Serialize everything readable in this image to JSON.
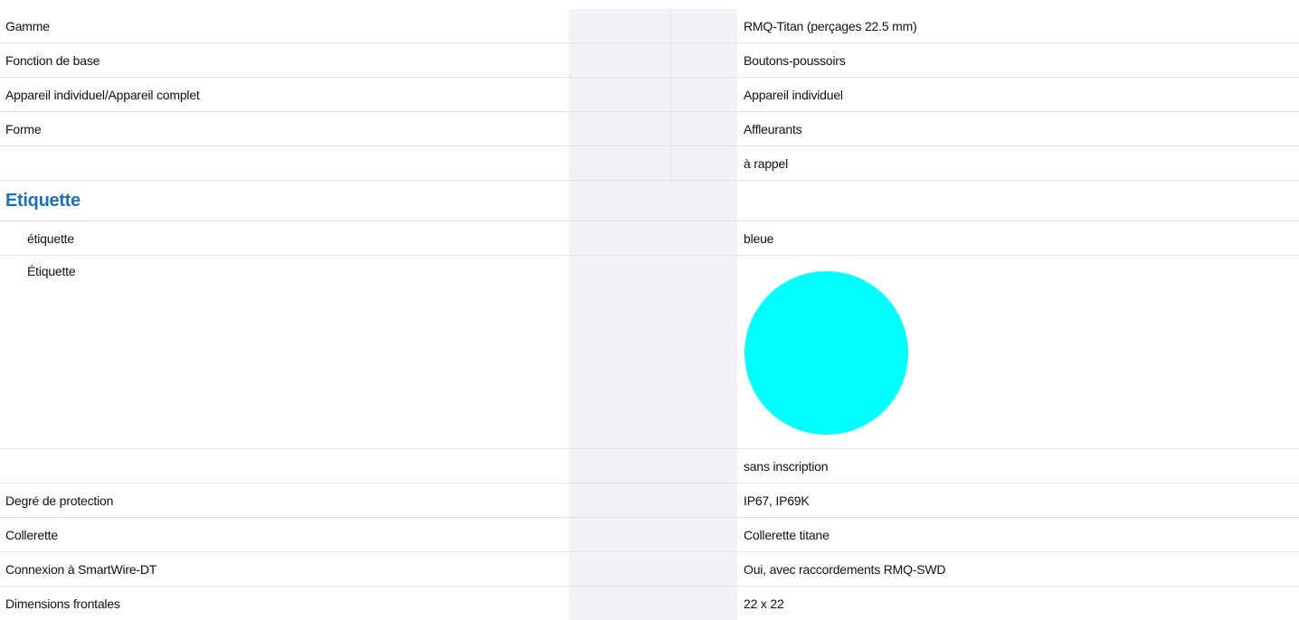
{
  "rows": [
    {
      "label": "Gamme",
      "value": "RMQ-Titan (perçages 22.5 mm)"
    },
    {
      "label": "Fonction de base",
      "value": "Boutons-poussoirs"
    },
    {
      "label": "Appareil individuel/Appareil complet",
      "value": "Appareil individuel"
    },
    {
      "label": "Forme",
      "value": "Affleurants"
    },
    {
      "label": "",
      "value": "à rappel"
    }
  ],
  "section": {
    "title": "Etiquette",
    "rows": [
      {
        "label": "étiquette",
        "value": "bleue"
      },
      {
        "label": "Étiquette",
        "swatch_color": "#00ffff",
        "swatch_shape": "circle"
      },
      {
        "label": "",
        "value": "sans inscription"
      }
    ]
  },
  "rows_after": [
    {
      "label": "Degré de protection",
      "value": "IP67, IP69K"
    },
    {
      "label": "Collerette",
      "value": "Collerette titane"
    },
    {
      "label": "Connexion à SmartWire-DT",
      "value": "Oui, avec raccordements RMQ-SWD"
    },
    {
      "label": "Dimensions frontales",
      "value": "22 x 22"
    }
  ],
  "colors": {
    "section_title": "#1b6fc2",
    "gutter": "#f0f2f6",
    "row_divider": "#e3e5ea"
  }
}
